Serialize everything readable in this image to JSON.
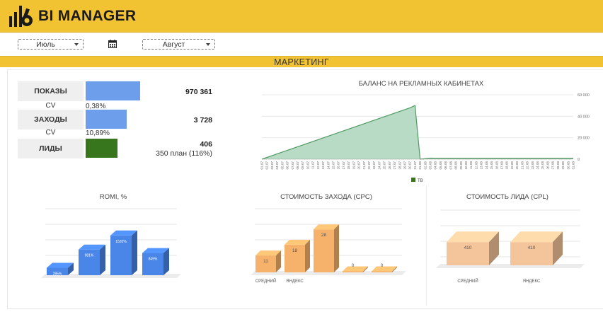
{
  "app": {
    "title": "BI MANAGER"
  },
  "filters": {
    "month_from": "Июль",
    "month_to": "Август",
    "calendar_icon": "calendar-icon"
  },
  "section": {
    "title": "МАРКЕТИНГ"
  },
  "kpis": {
    "impressions": {
      "label": "ПОКАЗЫ",
      "value": "970 361"
    },
    "cv1": {
      "label": "CV",
      "value": "0,38%"
    },
    "visits": {
      "label": "ЗАХОДЫ",
      "value": "3 728"
    },
    "cv2": {
      "label": "CV",
      "value": "10,89%"
    },
    "leads": {
      "label": "ЛИДЫ",
      "value": "406",
      "plan": "350 план (116%)"
    }
  },
  "colors": {
    "brand": "#f1c232",
    "blue": "#6d9eeb",
    "green": "#38761d",
    "area": "#b7dbc5",
    "area_line": "#4f9a63",
    "romi": "#4a86e8",
    "cpc": "#f6b26b",
    "cpl": "#f4c49a"
  },
  "chart_data": [
    {
      "type": "area",
      "title": "БАЛАНС НА РЕКЛАМНЫХ КАБИНЕТАХ",
      "y_ticks": [
        "0",
        "20 000",
        "40 000",
        "60 000"
      ],
      "ylim": [
        0,
        60000
      ],
      "x": [
        "01.07",
        "02.07",
        "03.07",
        "04.07",
        "05.07",
        "06.07",
        "07.07",
        "08.07",
        "09.07",
        "10.07",
        "11.07",
        "12.07",
        "13.07",
        "14.07",
        "15.07",
        "16.07",
        "17.07",
        "18.07",
        "19.07",
        "20.07",
        "21.07",
        "22.07",
        "23.07",
        "24.07",
        "25.07",
        "26.07",
        "27.07",
        "28.07",
        "29.07",
        "30.07",
        "31.07",
        "01.08",
        "02.08",
        "03.08",
        "04.08",
        "05.08",
        "06.08",
        "07.08",
        "08.08",
        "09.08",
        "10.08",
        "11.08",
        "12.08",
        "13.08",
        "14.08",
        "15.08",
        "16.08",
        "17.08",
        "18.08",
        "19.08",
        "20.08",
        "21.08",
        "22.08",
        "23.08",
        "24.08",
        "25.08",
        "26.08",
        "27.08",
        "28.08",
        "29.08",
        "30.08",
        "31.08"
      ],
      "series": [
        {
          "name": "ТВ",
          "values": [
            0,
            1650,
            3300,
            4950,
            6600,
            8250,
            9900,
            11550,
            13200,
            14850,
            16500,
            18150,
            19800,
            21450,
            23100,
            24750,
            26400,
            28050,
            29700,
            31350,
            33000,
            34650,
            36300,
            37950,
            39600,
            41250,
            42900,
            44550,
            46200,
            47850,
            50000,
            0,
            500,
            1000,
            800,
            800,
            800,
            800,
            800,
            800,
            800,
            800,
            800,
            800,
            800,
            800,
            800,
            800,
            800,
            800,
            800,
            800,
            800,
            800,
            800,
            800,
            800,
            800,
            800,
            800,
            800,
            800
          ]
        }
      ],
      "legend": "bottom"
    },
    {
      "type": "bar",
      "title": "ROMI, %",
      "categories": [
        "",
        "",
        "",
        ""
      ],
      "values": [
        285,
        981,
        1520,
        849
      ],
      "value_labels": [
        "285%",
        "981%",
        "1520%",
        "849%"
      ],
      "ylim": [
        0,
        2000
      ]
    },
    {
      "type": "bar",
      "title": "СТОИМОСТЬ ЗАХОДА (CPC)",
      "categories": [
        "СРЕДНИЙ",
        "ЯНДЕКС",
        "",
        "",
        ""
      ],
      "values": [
        11,
        18,
        28,
        0,
        0
      ],
      "ylim": [
        0,
        35
      ]
    },
    {
      "type": "bar",
      "title": "СТОИМОСТЬ ЛИДА (CPL)",
      "categories": [
        "СРЕДНИЙ",
        "ЯНДЕКС"
      ],
      "values": [
        410,
        410
      ],
      "ylim": [
        0,
        1000
      ]
    }
  ]
}
